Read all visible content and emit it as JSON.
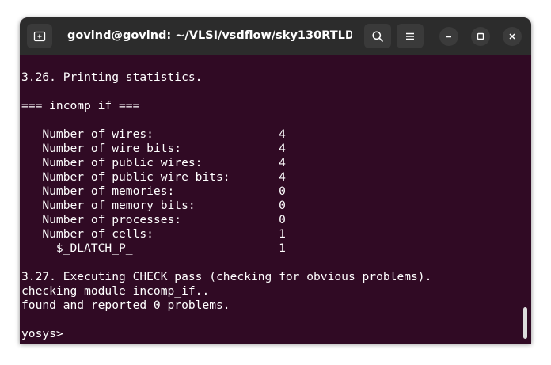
{
  "window": {
    "title": "govind@govind: ~/VLSI/vsdflow/sky130RTLDesi..."
  },
  "header": {
    "new_tab_icon": "new-tab-icon",
    "search_icon": "search-icon",
    "menu_icon": "hamburger-menu-icon",
    "minimize_icon": "minimize-icon",
    "maximize_icon": "maximize-icon",
    "close_icon": "close-icon"
  },
  "colors": {
    "terminal_background": "#300a24",
    "titlebar_background": "#2c2c2c",
    "text": "#ffffff"
  },
  "terminal": {
    "lines": [
      "3.26. Printing statistics.",
      "",
      "=== incomp_if ===",
      "",
      "   Number of wires:                  4",
      "   Number of wire bits:              4",
      "   Number of public wires:           4",
      "   Number of public wire bits:       4",
      "   Number of memories:               0",
      "   Number of memory bits:            0",
      "   Number of processes:              0",
      "   Number of cells:                  1",
      "     $_DLATCH_P_                     1",
      "",
      "3.27. Executing CHECK pass (checking for obvious problems).",
      "checking module incomp_if..",
      "found and reported 0 problems.",
      "",
      "yosys> "
    ]
  }
}
